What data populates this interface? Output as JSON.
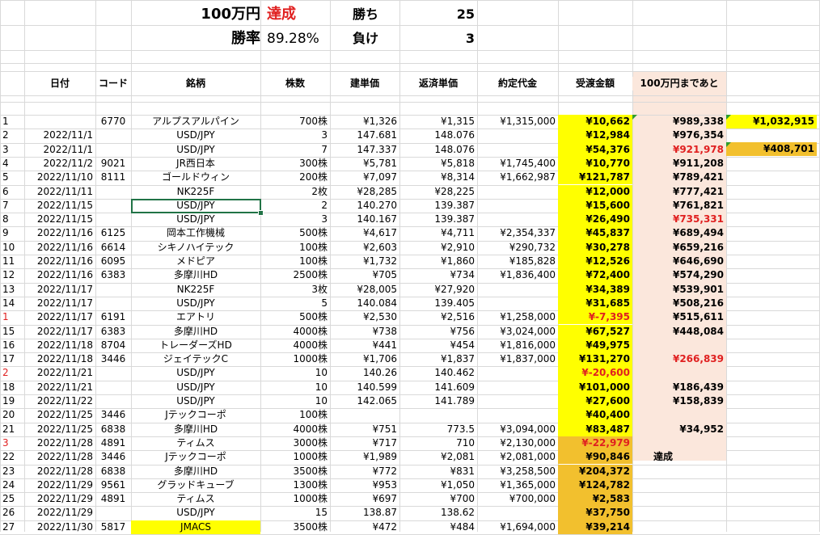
{
  "summary": {
    "goal_label": "100万円",
    "goal_status": "達成",
    "win_label": "勝ち",
    "win_count": "25",
    "rate_label": "勝率",
    "rate_value": "89.28%",
    "loss_label": "負け",
    "loss_count": "3"
  },
  "headers": {
    "date": "日付",
    "code": "コード",
    "name": "銘柄",
    "qty": "株数",
    "buy": "建単価",
    "sell": "返済単価",
    "contract": "約定代金",
    "received": "受渡金額",
    "remaining": "100万円まであと"
  },
  "side_values": {
    "top": "¥1,032,915",
    "second": "¥408,701"
  },
  "colors": {
    "yellow": "#ffff00",
    "gold": "#f2c02e",
    "peach": "#fbe7dc",
    "red": "#e02020",
    "selection": "#217346"
  },
  "rows": [
    {
      "no": "1",
      "date": "",
      "code": "6770",
      "name": "アルプスアルパイン",
      "qty": "700株",
      "buy": "¥1,326",
      "sell": "¥1,315",
      "contract": "¥1,315,000",
      "received": "¥10,662",
      "remaining": "¥989,338",
      "no_red": false,
      "recv_red": false,
      "rem_red": false
    },
    {
      "no": "2",
      "date": "2022/11/1",
      "code": "",
      "name": "USD/JPY",
      "qty": "3",
      "buy": "147.681",
      "sell": "148.076",
      "contract": "",
      "received": "¥12,984",
      "remaining": "¥976,354",
      "no_red": false,
      "recv_red": false,
      "rem_red": false
    },
    {
      "no": "3",
      "date": "2022/11/1",
      "code": "",
      "name": "USD/JPY",
      "qty": "7",
      "buy": "147.337",
      "sell": "148.076",
      "contract": "",
      "received": "¥54,376",
      "remaining": "¥921,978",
      "no_red": false,
      "recv_red": false,
      "rem_red": true
    },
    {
      "no": "4",
      "date": "2022/11/2",
      "code": "9021",
      "name": "JR西日本",
      "qty": "300株",
      "buy": "¥5,781",
      "sell": "¥5,818",
      "contract": "¥1,745,400",
      "received": "¥10,770",
      "remaining": "¥911,208",
      "no_red": false,
      "recv_red": false,
      "rem_red": false
    },
    {
      "no": "5",
      "date": "2022/11/10",
      "code": "8111",
      "name": "ゴールドウィン",
      "qty": "200株",
      "buy": "¥7,097",
      "sell": "¥8,314",
      "contract": "¥1,662,987",
      "received": "¥121,787",
      "remaining": "¥789,421",
      "no_red": false,
      "recv_red": false,
      "rem_red": false
    },
    {
      "no": "6",
      "date": "2022/11/11",
      "code": "",
      "name": "NK225F",
      "qty": "2枚",
      "buy": "¥28,285",
      "sell": "¥28,225",
      "contract": "",
      "received": "¥12,000",
      "remaining": "¥777,421",
      "no_red": false,
      "recv_red": false,
      "rem_red": false
    },
    {
      "no": "7",
      "date": "2022/11/15",
      "code": "",
      "name": "USD/JPY",
      "qty": "2",
      "buy": "140.270",
      "sell": "139.387",
      "contract": "",
      "received": "¥15,600",
      "remaining": "¥761,821",
      "no_red": false,
      "recv_red": false,
      "rem_red": false
    },
    {
      "no": "8",
      "date": "2022/11/15",
      "code": "",
      "name": "USD/JPY",
      "qty": "3",
      "buy": "140.167",
      "sell": "139.387",
      "contract": "",
      "received": "¥26,490",
      "remaining": "¥735,331",
      "no_red": false,
      "recv_red": false,
      "rem_red": true
    },
    {
      "no": "9",
      "date": "2022/11/16",
      "code": "6125",
      "name": "岡本工作機械",
      "qty": "500株",
      "buy": "¥4,617",
      "sell": "¥4,711",
      "contract": "¥2,354,337",
      "received": "¥45,837",
      "remaining": "¥689,494",
      "no_red": false,
      "recv_red": false,
      "rem_red": false
    },
    {
      "no": "10",
      "date": "2022/11/16",
      "code": "6614",
      "name": "シキノハイテック",
      "qty": "100株",
      "buy": "¥2,603",
      "sell": "¥2,910",
      "contract": "¥290,732",
      "received": "¥30,278",
      "remaining": "¥659,216",
      "no_red": false,
      "recv_red": false,
      "rem_red": false
    },
    {
      "no": "11",
      "date": "2022/11/16",
      "code": "6095",
      "name": "メドピア",
      "qty": "100株",
      "buy": "¥1,732",
      "sell": "¥1,860",
      "contract": "¥185,828",
      "received": "¥12,526",
      "remaining": "¥646,690",
      "no_red": false,
      "recv_red": false,
      "rem_red": false
    },
    {
      "no": "12",
      "date": "2022/11/16",
      "code": "6383",
      "name": "多摩川HD",
      "qty": "2500株",
      "buy": "¥705",
      "sell": "¥734",
      "contract": "¥1,836,400",
      "received": "¥72,400",
      "remaining": "¥574,290",
      "no_red": false,
      "recv_red": false,
      "rem_red": false
    },
    {
      "no": "13",
      "date": "2022/11/17",
      "code": "",
      "name": "NK225F",
      "qty": "3枚",
      "buy": "¥28,005",
      "sell": "¥27,920",
      "contract": "",
      "received": "¥34,389",
      "remaining": "¥539,901",
      "no_red": false,
      "recv_red": false,
      "rem_red": false
    },
    {
      "no": "14",
      "date": "2022/11/17",
      "code": "",
      "name": "USD/JPY",
      "qty": "5",
      "buy": "140.084",
      "sell": "139.405",
      "contract": "",
      "received": "¥31,685",
      "remaining": "¥508,216",
      "no_red": false,
      "recv_red": false,
      "rem_red": false
    },
    {
      "no": "1",
      "date": "2022/11/17",
      "code": "6191",
      "name": "エアトリ",
      "qty": "500株",
      "buy": "¥2,530",
      "sell": "¥2,516",
      "contract": "¥1,258,000",
      "received": "¥-7,395",
      "remaining": "¥515,611",
      "no_red": true,
      "recv_red": true,
      "rem_red": false
    },
    {
      "no": "15",
      "date": "2022/11/17",
      "code": "6383",
      "name": "多摩川HD",
      "qty": "4000株",
      "buy": "¥738",
      "sell": "¥756",
      "contract": "¥3,024,000",
      "received": "¥67,527",
      "remaining": "¥448,084",
      "no_red": false,
      "recv_red": false,
      "rem_red": false
    },
    {
      "no": "16",
      "date": "2022/11/18",
      "code": "8704",
      "name": "トレーダーズHD",
      "qty": "4000株",
      "buy": "¥441",
      "sell": "¥454",
      "contract": "¥1,816,000",
      "received": "¥49,975",
      "remaining": "",
      "no_red": false,
      "recv_red": false,
      "rem_red": false
    },
    {
      "no": "17",
      "date": "2022/11/18",
      "code": "3446",
      "name": "ジェイテックC",
      "qty": "1000株",
      "buy": "¥1,706",
      "sell": "¥1,837",
      "contract": "¥1,837,000",
      "received": "¥131,270",
      "remaining": "¥266,839",
      "no_red": false,
      "recv_red": false,
      "rem_red": true
    },
    {
      "no": "2",
      "date": "2022/11/21",
      "code": "",
      "name": "USD/JPY",
      "qty": "10",
      "buy": "140.26",
      "sell": "140.462",
      "contract": "",
      "received": "¥-20,600",
      "remaining": "",
      "no_red": true,
      "recv_red": true,
      "rem_red": false
    },
    {
      "no": "18",
      "date": "2022/11/21",
      "code": "",
      "name": "USD/JPY",
      "qty": "10",
      "buy": "140.599",
      "sell": "141.609",
      "contract": "",
      "received": "¥101,000",
      "remaining": "¥186,439",
      "no_red": false,
      "recv_red": false,
      "rem_red": false
    },
    {
      "no": "19",
      "date": "2022/11/22",
      "code": "",
      "name": "USD/JPY",
      "qty": "10",
      "buy": "142.065",
      "sell": "141.789",
      "contract": "",
      "received": "¥27,600",
      "remaining": "¥158,839",
      "no_red": false,
      "recv_red": false,
      "rem_red": false
    },
    {
      "no": "20",
      "date": "2022/11/25",
      "code": "3446",
      "name": "Jテックコーポ",
      "qty": "100株",
      "buy": "",
      "sell": "",
      "contract": "",
      "received": "¥40,400",
      "remaining": "",
      "no_red": false,
      "recv_red": false,
      "rem_red": false
    },
    {
      "no": "21",
      "date": "2022/11/25",
      "code": "6838",
      "name": "多摩川HD",
      "qty": "4000株",
      "buy": "¥751",
      "sell": "773.5",
      "contract": "¥3,094,000",
      "received": "¥83,487",
      "remaining": "¥34,952",
      "no_red": false,
      "recv_red": false,
      "rem_red": false
    },
    {
      "no": "3",
      "date": "2022/11/28",
      "code": "4891",
      "name": "ティムス",
      "qty": "3000株",
      "buy": "¥717",
      "sell": "710",
      "contract": "¥2,130,000",
      "received": "¥-22,979",
      "remaining": "",
      "no_red": true,
      "recv_red": true,
      "rem_red": false
    },
    {
      "no": "22",
      "date": "2022/11/28",
      "code": "3446",
      "name": "Jテックコーポ",
      "qty": "1000株",
      "buy": "¥1,989",
      "sell": "¥2,081",
      "contract": "¥2,081,000",
      "received": "¥90,846",
      "remaining": "達成",
      "no_red": false,
      "recv_red": false,
      "rem_red": false
    },
    {
      "no": "23",
      "date": "2022/11/28",
      "code": "6838",
      "name": "多摩川HD",
      "qty": "3500株",
      "buy": "¥772",
      "sell": "¥831",
      "contract": "¥3,258,500",
      "received": "¥204,372",
      "remaining": "",
      "no_red": false,
      "recv_red": false,
      "rem_red": false
    },
    {
      "no": "24",
      "date": "2022/11/29",
      "code": "9561",
      "name": "グラッドキューブ",
      "qty": "1300株",
      "buy": "¥953",
      "sell": "¥1,050",
      "contract": "¥1,365,000",
      "received": "¥124,782",
      "remaining": "",
      "no_red": false,
      "recv_red": false,
      "rem_red": false
    },
    {
      "no": "25",
      "date": "2022/11/29",
      "code": "4891",
      "name": "ティムス",
      "qty": "1000株",
      "buy": "¥697",
      "sell": "¥700",
      "contract": "¥700,000",
      "received": "¥2,583",
      "remaining": "",
      "no_red": false,
      "recv_red": false,
      "rem_red": false
    },
    {
      "no": "26",
      "date": "2022/11/29",
      "code": "",
      "name": "USD/JPY",
      "qty": "15",
      "buy": "138.87",
      "sell": "138.62",
      "contract": "",
      "received": "¥37,750",
      "remaining": "",
      "no_red": false,
      "recv_red": false,
      "rem_red": false
    },
    {
      "no": "27",
      "date": "2022/11/30",
      "code": "5817",
      "name": "JMACS",
      "qty": "3500株",
      "buy": "¥472",
      "sell": "¥484",
      "contract": "¥1,694,000",
      "received": "¥39,214",
      "remaining": "",
      "no_red": false,
      "recv_red": false,
      "rem_red": false
    }
  ]
}
